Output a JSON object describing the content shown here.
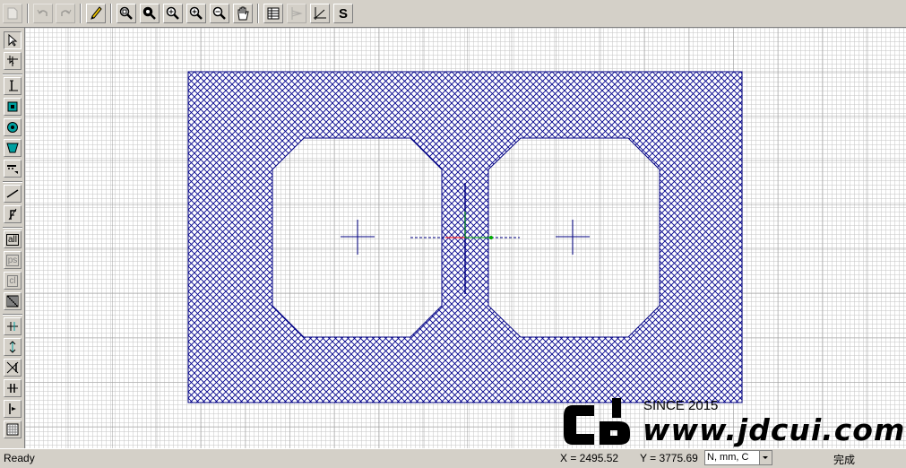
{
  "toolbar": {
    "buttons": [
      {
        "icon": "new-document-icon"
      },
      {
        "icon": "undo-icon"
      },
      {
        "icon": "redo-icon"
      },
      {
        "icon": "pencil-icon"
      },
      {
        "icon": "zoom-window-icon"
      },
      {
        "icon": "zoom-realtime-icon"
      },
      {
        "icon": "zoom-in-icon"
      },
      {
        "icon": "zoom-extents-icon"
      },
      {
        "icon": "zoom-out-icon"
      },
      {
        "icon": "pan-hand-icon"
      },
      {
        "icon": "table-icon"
      },
      {
        "icon": "section-icon"
      },
      {
        "icon": "angle-icon"
      },
      {
        "icon": "s-icon"
      }
    ],
    "s_label": "S"
  },
  "left_tools": {
    "text_all": "all",
    "text_ps": "ps",
    "text_cl": "cl"
  },
  "status": {
    "ready": "Ready",
    "x_readout": "X = 2495.52",
    "y_readout": "Y = 3775.69",
    "units": "N, mm, C",
    "done": "完成"
  },
  "watermark": {
    "since": "SINCE 2015",
    "url": "www.jdcui.com"
  },
  "colors": {
    "hatch": "#00008b",
    "outline": "#000080",
    "cross": "#000080",
    "axis_x": "#ff0000",
    "axis_y": "#00aa00"
  }
}
